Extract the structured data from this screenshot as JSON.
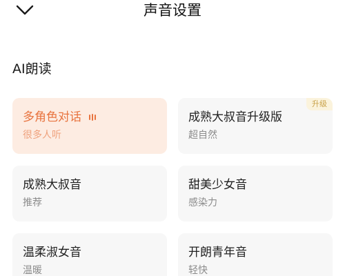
{
  "header": {
    "title": "声音设置"
  },
  "section": {
    "title": "AI朗读"
  },
  "voices": [
    {
      "title": "多角色对话",
      "subtitle": "很多人听",
      "selected": true,
      "playing": true
    },
    {
      "title": "成熟大叔音升级版",
      "subtitle": "超自然",
      "badge": "升级"
    },
    {
      "title": "成熟大叔音",
      "subtitle": "推荐"
    },
    {
      "title": "甜美少女音",
      "subtitle": "感染力"
    },
    {
      "title": "温柔淑女音",
      "subtitle": "温暖"
    },
    {
      "title": "开朗青年音",
      "subtitle": "轻快"
    }
  ],
  "colors": {
    "accent": "#e8733e",
    "selected_card_bg": "#fdece2",
    "card_bg": "#f7f7f7",
    "badge_bg": "#fbf3dc",
    "badge_text": "#c9a24a"
  },
  "icons": {
    "back": "chevron-down-icon",
    "playing": "sound-bars-icon"
  }
}
